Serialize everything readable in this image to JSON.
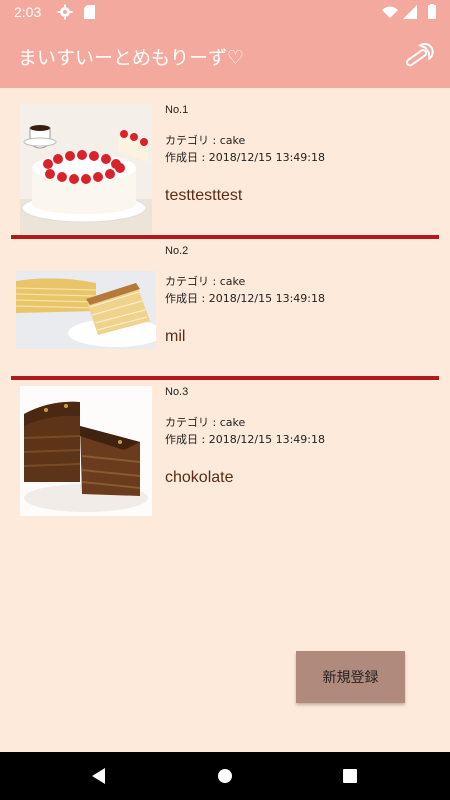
{
  "status_bar": {
    "time": "2:03"
  },
  "app_bar": {
    "title": "まいすいーとめもりーず♡"
  },
  "items": [
    {
      "no": "No.1",
      "category": "カテゴリ : cake",
      "created": "作成日 : 2018/12/15 13:49:18",
      "name": "testtesttest",
      "image": "strawberry-cake"
    },
    {
      "no": "No.2",
      "category": "カテゴリ : cake",
      "created": "作成日 : 2018/12/15 13:49:18",
      "name": "mil",
      "image": "mille-crepe"
    },
    {
      "no": "No.3",
      "category": "カテゴリ : cake",
      "created": "作成日 : 2018/12/15 13:49:18",
      "name": "chokolate",
      "image": "chocolate-cake"
    }
  ],
  "fab": {
    "label": "新規登録"
  },
  "colors": {
    "app_bar": "#f3a99d",
    "background": "#fdeadb",
    "divider": "#b3191b",
    "button": "#b08a7c"
  }
}
